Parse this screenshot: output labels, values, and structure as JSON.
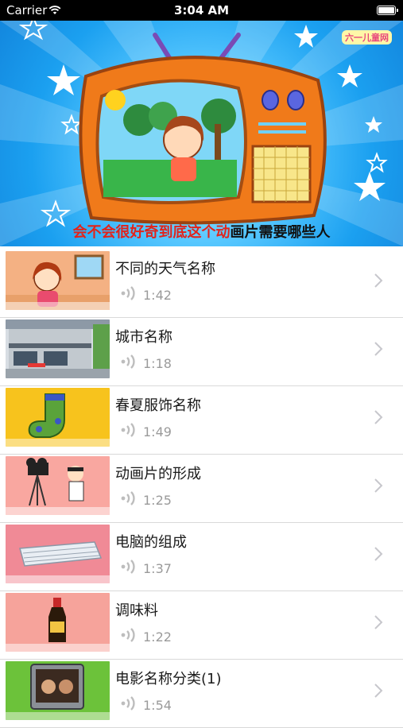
{
  "status_bar": {
    "carrier": "Carrier",
    "time": "3:04 AM",
    "battery_level": 1.0
  },
  "hero": {
    "logo_text": "六一儿童网",
    "subtitle_highlight": "会不会很好奇到底这个动",
    "subtitle_rest": "画片需要哪些人"
  },
  "list": [
    {
      "title": "不同的天气名称",
      "duration": "1:42",
      "thumb": "girl-window"
    },
    {
      "title": "城市名称",
      "duration": "1:18",
      "thumb": "building"
    },
    {
      "title": "春夏服饰名称",
      "duration": "1:49",
      "thumb": "socks"
    },
    {
      "title": "动画片的形成",
      "duration": "1:25",
      "thumb": "director-camera"
    },
    {
      "title": "电脑的组成",
      "duration": "1:37",
      "thumb": "keyboard"
    },
    {
      "title": "调味料",
      "duration": "1:22",
      "thumb": "sauce-bottle"
    },
    {
      "title": "电影名称分类(1)",
      "duration": "1:54",
      "thumb": "movie-tv"
    }
  ],
  "icons": {
    "row_audio": "speaker-icon",
    "row_disclosure": "chevron-right-icon"
  },
  "colors": {
    "subtitle_highlight": "#e2231a",
    "separator": "#d9d9d9",
    "duration_text": "#9a9a9a"
  }
}
